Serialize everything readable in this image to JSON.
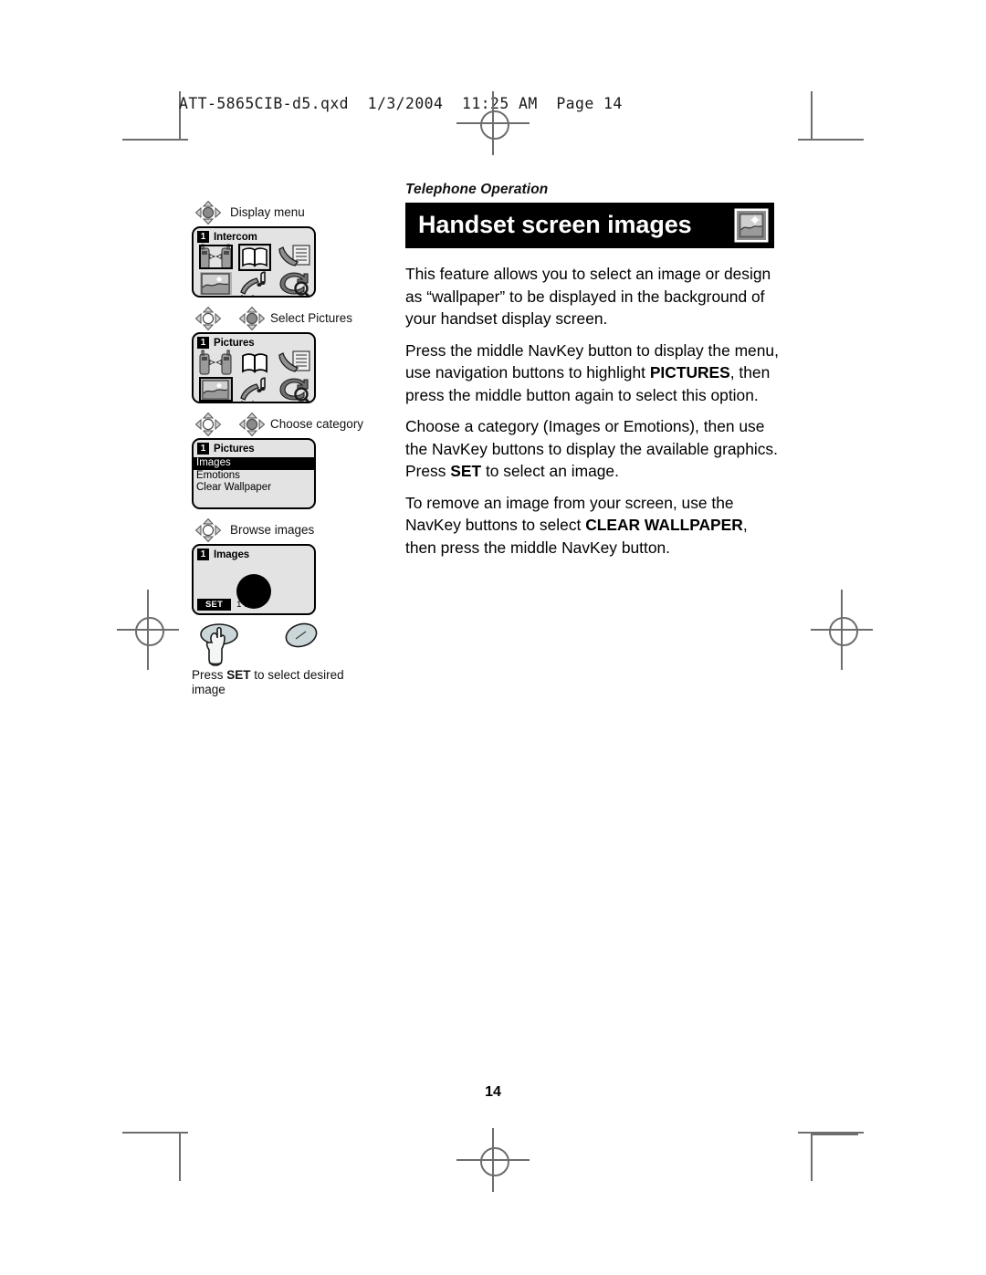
{
  "preflight": {
    "line": "ATT-5865CIB-d5.qxd  1/3/2004  11:25 AM  Page 14"
  },
  "header": {
    "running_head": "Telephone Operation",
    "title": "Handset screen images",
    "icon": "picture-frame-icon",
    "bar_color": "#000000"
  },
  "body": {
    "paragraphs": [
      {
        "runs": [
          {
            "text": "This feature allows you to select an image or design as “wallpaper” to be displayed in the background of your handset display screen.",
            "bold": false
          }
        ]
      },
      {
        "runs": [
          {
            "text": "Press the middle NavKey button to display the menu, use navigation buttons to highlight ",
            "bold": false
          },
          {
            "text": "PICTURES",
            "bold": true
          },
          {
            "text": ", then press the middle button again to select this option.",
            "bold": false
          }
        ]
      },
      {
        "runs": [
          {
            "text": "Choose a category (Images or Emotions), then use the NavKey buttons to display the available graphics. Press ",
            "bold": false
          },
          {
            "text": "SET",
            "bold": true
          },
          {
            "text": " to select an image.",
            "bold": false
          }
        ]
      },
      {
        "runs": [
          {
            "text": "To remove an image from your screen, use the NavKey buttons to select ",
            "bold": false
          },
          {
            "text": "CLEAR WALLPAPER",
            "bold": true
          },
          {
            "text": ", then press the middle NavKey button.",
            "bold": false
          }
        ]
      }
    ]
  },
  "illustration": {
    "steps": [
      {
        "label": "Display menu",
        "navkeys": [
          {
            "state": "pressed"
          }
        ],
        "screen": {
          "type": "icon-grid",
          "badge": "1",
          "title": "Intercom",
          "icons": [
            {
              "name": "intercom-icon",
              "selected": true,
              "shaded": false
            },
            {
              "name": "phonebook-icon",
              "selected": false,
              "shaded": false
            },
            {
              "name": "caller-id-icon",
              "selected": false,
              "shaded": false
            },
            {
              "name": "pictures-icon",
              "selected": false,
              "shaded": true
            },
            {
              "name": "ringers-icon",
              "selected": false,
              "shaded": false
            },
            {
              "name": "settings-icon",
              "selected": false,
              "shaded": false
            }
          ]
        }
      },
      {
        "label": "Select Pictures",
        "navkeys": [
          {
            "state": "open"
          },
          {
            "state": "pressed"
          }
        ],
        "screen": {
          "type": "icon-grid",
          "badge": "1",
          "title": "Pictures",
          "icons": [
            {
              "name": "intercom-icon",
              "selected": false,
              "shaded": false
            },
            {
              "name": "phonebook-icon",
              "selected": false,
              "shaded": false
            },
            {
              "name": "caller-id-icon",
              "selected": false,
              "shaded": false
            },
            {
              "name": "pictures-icon",
              "selected": true,
              "shaded": true
            },
            {
              "name": "ringers-icon",
              "selected": false,
              "shaded": false
            },
            {
              "name": "settings-icon",
              "selected": false,
              "shaded": false
            }
          ]
        }
      },
      {
        "label": "Choose category",
        "navkeys": [
          {
            "state": "open"
          },
          {
            "state": "pressed"
          }
        ],
        "screen": {
          "type": "list",
          "badge": "1",
          "title": "Pictures",
          "items": [
            {
              "label": "Images",
              "highlighted": true
            },
            {
              "label": "Emotions",
              "highlighted": false
            },
            {
              "label": "Clear Wallpaper",
              "highlighted": false
            }
          ]
        }
      },
      {
        "label": "Browse images",
        "navkeys": [
          {
            "state": "open"
          }
        ],
        "screen": {
          "type": "image-preview",
          "badge": "1",
          "title": "Images",
          "softkey": "SET",
          "counter": "1 of 16"
        }
      }
    ],
    "caption": {
      "runs": [
        {
          "text": "Press ",
          "bold": false
        },
        {
          "text": "SET",
          "bold": true
        },
        {
          "text": " to select desired image",
          "bold": false
        }
      ]
    },
    "buttons": [
      {
        "name": "set-button-with-hand",
        "hand": true
      },
      {
        "name": "navkey-oval-button",
        "hand": false
      }
    ]
  },
  "folio": {
    "page_number": "14"
  }
}
